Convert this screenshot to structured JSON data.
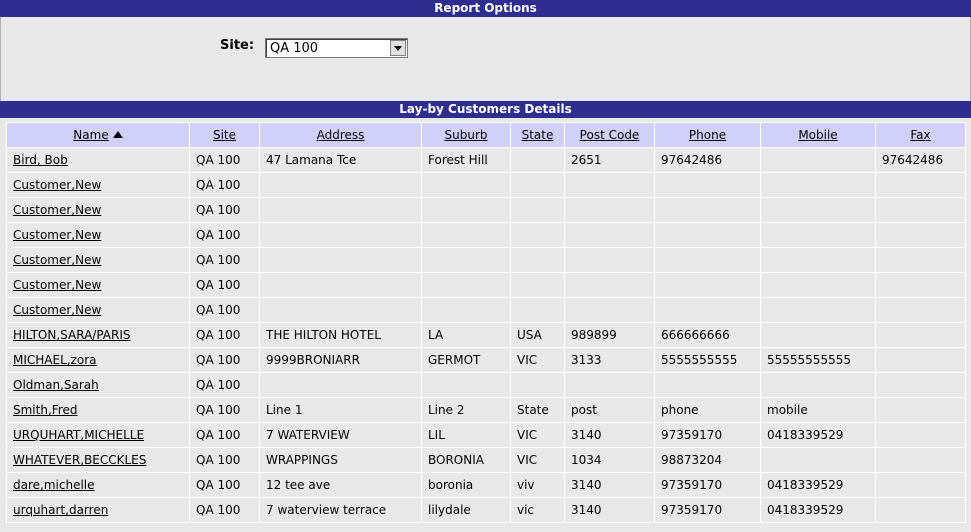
{
  "options": {
    "header": "Report Options",
    "site_label": "Site:",
    "site_value": "QA 100"
  },
  "details": {
    "header": "Lay-by Customers Details",
    "columns": [
      "Name",
      "Site",
      "Address",
      "Suburb",
      "State",
      "Post Code",
      "Phone",
      "Mobile",
      "Fax"
    ],
    "rows": [
      [
        "Bird, Bob",
        "QA 100",
        "47 Lamana Tce",
        "Forest Hill",
        "",
        "2651",
        "97642486",
        "",
        "97642486"
      ],
      [
        "Customer,New",
        "QA 100",
        "",
        "",
        "",
        "",
        "",
        "",
        ""
      ],
      [
        "Customer,New",
        "QA 100",
        "",
        "",
        "",
        "",
        "",
        "",
        ""
      ],
      [
        "Customer,New",
        "QA 100",
        "",
        "",
        "",
        "",
        "",
        "",
        ""
      ],
      [
        "Customer,New",
        "QA 100",
        "",
        "",
        "",
        "",
        "",
        "",
        ""
      ],
      [
        "Customer,New",
        "QA 100",
        "",
        "",
        "",
        "",
        "",
        "",
        ""
      ],
      [
        "Customer,New",
        "QA 100",
        "",
        "",
        "",
        "",
        "",
        "",
        ""
      ],
      [
        "HILTON,SARA/PARIS",
        "QA 100",
        "THE HILTON HOTEL",
        "LA",
        "USA",
        "989899",
        "666666666",
        "",
        ""
      ],
      [
        "MICHAEL,zora",
        "QA 100",
        "9999BRONIARR",
        "GERMOT",
        "VIC",
        "3133",
        "5555555555",
        "55555555555",
        ""
      ],
      [
        "Oldman,Sarah",
        "QA 100",
        "",
        "",
        "",
        "",
        "",
        "",
        ""
      ],
      [
        "Smith,Fred",
        "QA 100",
        "Line 1",
        "Line 2",
        "State",
        "post",
        "phone",
        "mobile",
        ""
      ],
      [
        "URQUHART,MICHELLE",
        "QA 100",
        "7 WATERVIEW",
        "LIL",
        "VIC",
        "3140",
        "97359170",
        "0418339529",
        ""
      ],
      [
        "WHATEVER,BECCKLES",
        "QA 100",
        "WRAPPINGS",
        "BORONIA",
        "VIC",
        "1034",
        "98873204",
        "",
        ""
      ],
      [
        "dare,michelle",
        "QA 100",
        "12 tee ave",
        "boronia",
        "viv",
        "3140",
        "97359170",
        "0418339529",
        ""
      ],
      [
        "urquhart,darren",
        "QA 100",
        "7 waterview terrace",
        "lilydale",
        "vic",
        "3140",
        "97359170",
        "0418339529",
        ""
      ]
    ]
  }
}
